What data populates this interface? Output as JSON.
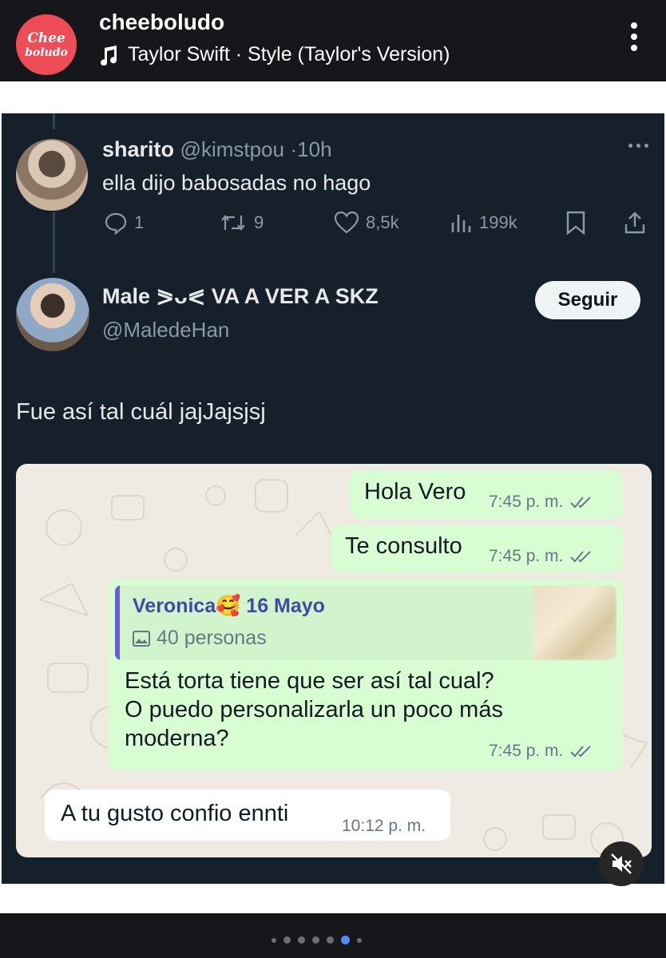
{
  "instagram": {
    "account_logo": {
      "line1": "Chee",
      "line2": "boludo"
    },
    "username": "cheeboludo",
    "audio": "Taylor Swift · Style (Taylor's Version)",
    "carousel": {
      "count": 7,
      "active_index": 5
    }
  },
  "tweet_reply": {
    "name": "sharito",
    "handle": "@kimstpou",
    "time_sep": "·",
    "time": "10h",
    "text": "ella dijo babosadas no hago",
    "replies": "1",
    "retweets": "9",
    "likes": "8,5k",
    "views": "199k"
  },
  "tweet_main": {
    "name": "Male ⪖ᴗ⪕ VA A VER A SKZ",
    "handle": "@MaledeHan",
    "follow_label": "Seguir",
    "text": "Fue así tal cuál jajJajsjsj"
  },
  "chat": {
    "messages": [
      {
        "text": "Hola Vero",
        "time": "7:45 p. m.",
        "outgoing": true
      },
      {
        "text": "Te consulto",
        "time": "7:45 p. m.",
        "outgoing": true
      },
      {
        "quote_name": "Veronica🥰 16 Mayo",
        "quote_sub": "40 personas",
        "lines": [
          "Está torta tiene que ser así tal cual?",
          "O puedo personalizarla un poco más",
          "moderna?"
        ],
        "time": "7:45 p. m.",
        "outgoing": true
      },
      {
        "text": "A tu gusto confio ennti",
        "time": "10:12 p. m.",
        "outgoing": false
      }
    ]
  },
  "colors": {
    "follow_bg": "#eff3f4",
    "bubble_out": "#d9fdd3",
    "bubble_in": "#ffffff",
    "carousel_active": "#4f8df7"
  }
}
